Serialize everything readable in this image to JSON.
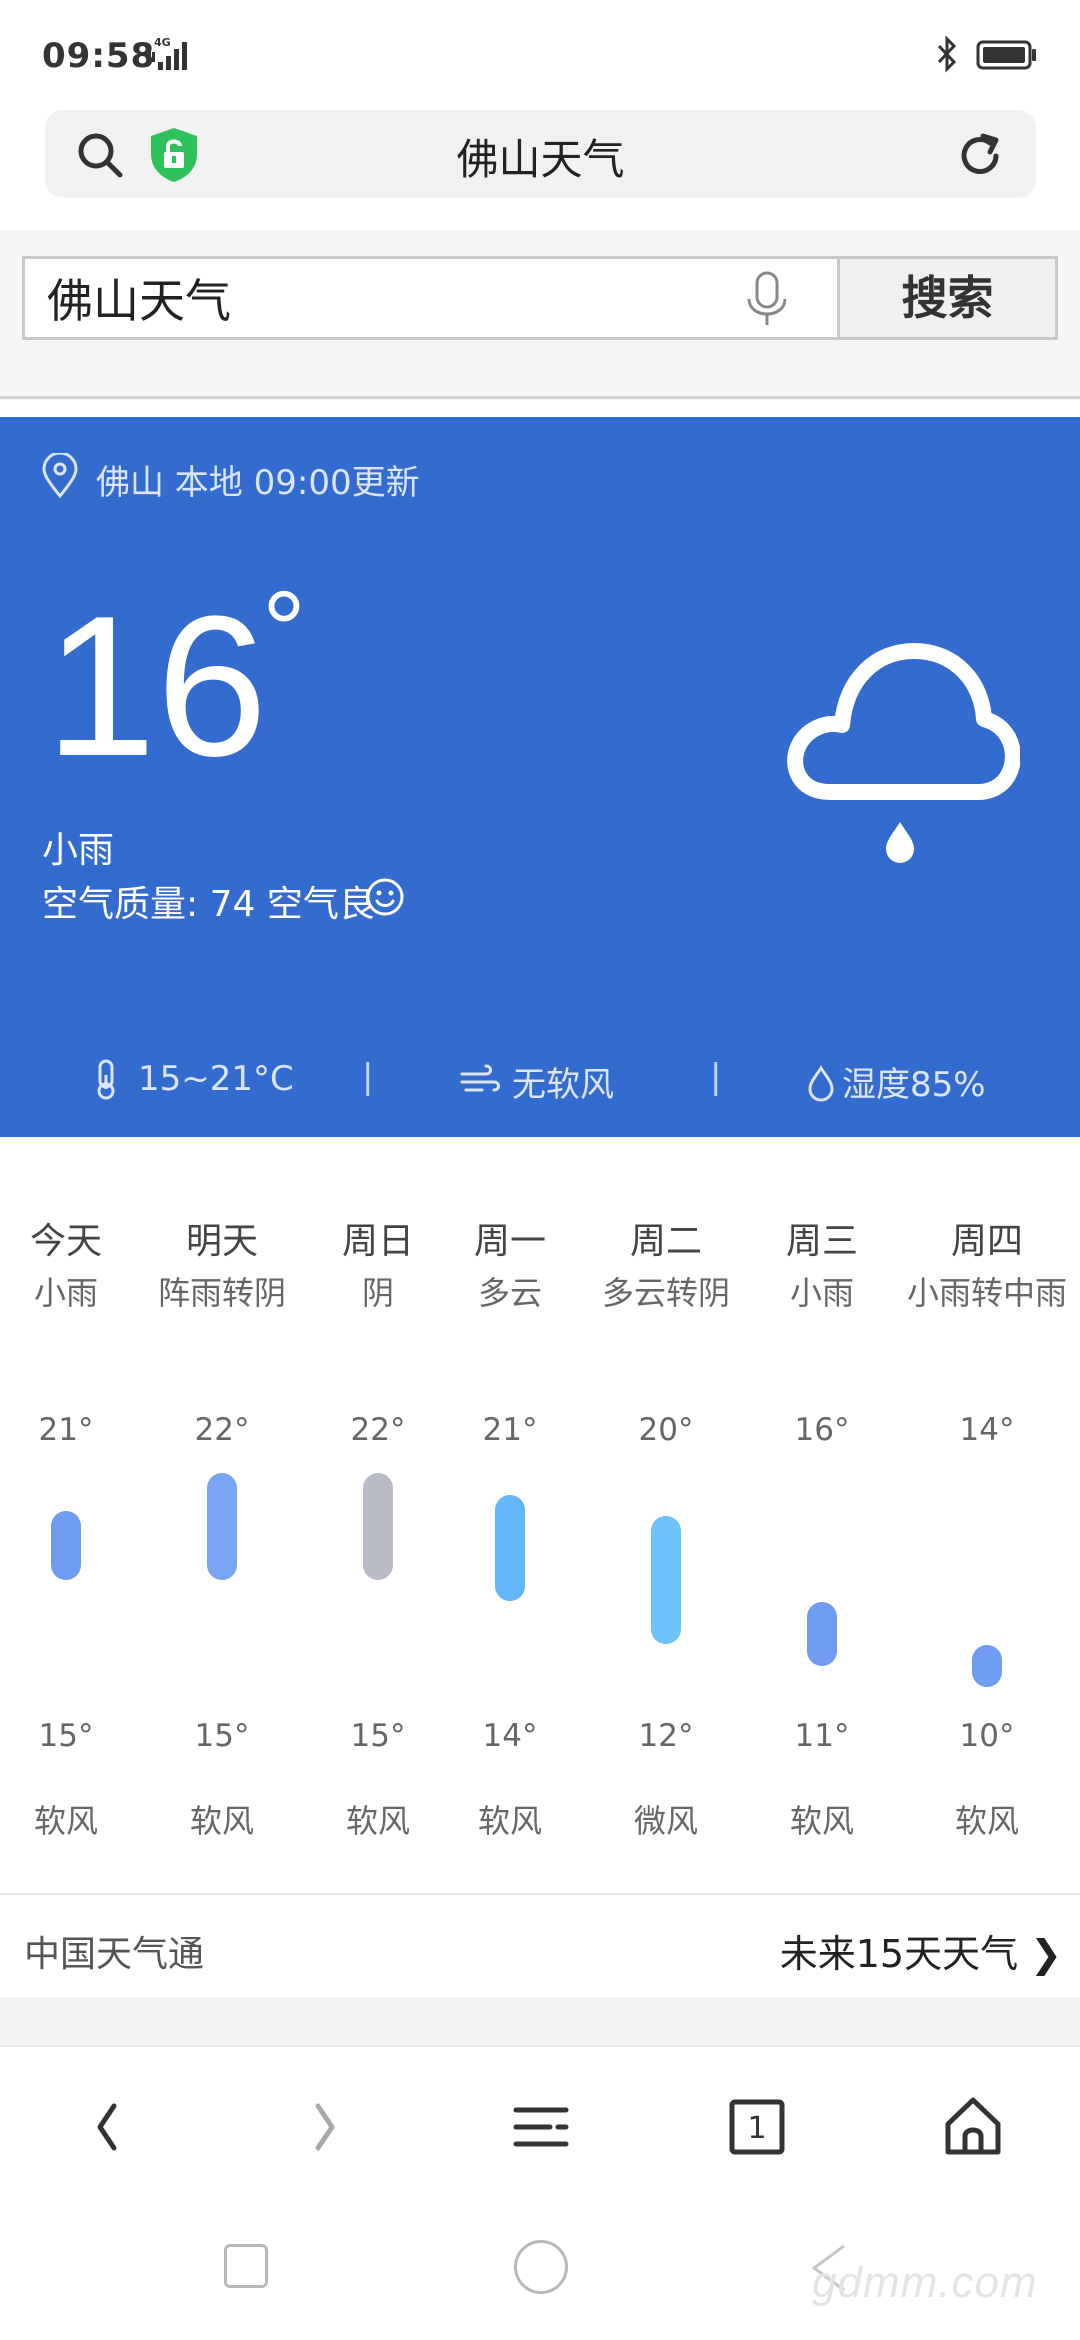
{
  "status": {
    "time": "09:58",
    "network": "4G"
  },
  "address_bar": {
    "title": "佛山天气"
  },
  "search": {
    "value": "佛山天气",
    "button_label": "搜索"
  },
  "weather": {
    "location": "佛山 本地 09:00更新",
    "temperature": "16",
    "degree": "°",
    "condition": "小雨",
    "air_quality": "空气质量: 74 空气良",
    "temp_range": "15~21°C",
    "wind": "无软风",
    "humidity": "湿度85%",
    "separator": "|"
  },
  "forecast": [
    {
      "day": "今天",
      "condition": "小雨",
      "high": "21°",
      "low": "15°",
      "wind": "软风",
      "color": "#6f9cf0"
    },
    {
      "day": "明天",
      "condition": "阵雨转阴",
      "high": "22°",
      "low": "15°",
      "wind": "软风",
      "color": "#79a4f3"
    },
    {
      "day": "周日",
      "condition": "阴",
      "high": "22°",
      "low": "15°",
      "wind": "软风",
      "color": "#b9bcc6"
    },
    {
      "day": "周一",
      "condition": "多云",
      "high": "21°",
      "low": "14°",
      "wind": "软风",
      "color": "#62b7f8"
    },
    {
      "day": "周二",
      "condition": "多云转阴",
      "high": "20°",
      "low": "12°",
      "wind": "微风",
      "color": "#6cc2f9"
    },
    {
      "day": "周三",
      "condition": "小雨",
      "high": "16°",
      "low": "11°",
      "wind": "软风",
      "color": "#6f9cf0"
    },
    {
      "day": "周四",
      "condition": "小雨转中雨",
      "high": "14°",
      "low": "10°",
      "wind": "软风",
      "color": "#6f9cf0"
    }
  ],
  "source": {
    "name": "中国天气通",
    "link": "未来15天天气 ❯"
  },
  "toolbar": {
    "tab_count": "1"
  },
  "watermark": "gdmm.com"
}
